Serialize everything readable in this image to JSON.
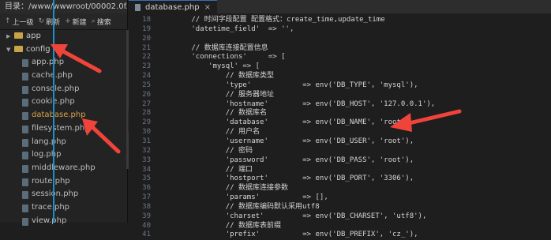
{
  "window": {
    "dir_label": "目录：/www/wwwroot/00002.0f..."
  },
  "toolbar": {
    "up": "上一级",
    "refresh": "刷新",
    "new": "新建",
    "search": "搜索"
  },
  "tree": [
    {
      "type": "folder",
      "label": "app",
      "open": false
    },
    {
      "type": "folder",
      "label": "config",
      "open": true
    },
    {
      "type": "file",
      "label": "app.php"
    },
    {
      "type": "file",
      "label": "cache.php"
    },
    {
      "type": "file",
      "label": "console.php"
    },
    {
      "type": "file",
      "label": "cookie.php"
    },
    {
      "type": "file",
      "label": "database.php",
      "active": true
    },
    {
      "type": "file",
      "label": "filesystem.php"
    },
    {
      "type": "file",
      "label": "lang.php"
    },
    {
      "type": "file",
      "label": "log.php"
    },
    {
      "type": "file",
      "label": "middleware.php"
    },
    {
      "type": "file",
      "label": "route.php"
    },
    {
      "type": "file",
      "label": "session.php"
    },
    {
      "type": "file",
      "label": "trace.php"
    },
    {
      "type": "file",
      "label": "view.php"
    }
  ],
  "tab": {
    "label": "database.php"
  },
  "code_lines": [
    {
      "n": "18",
      "t": "        // 时间字段配置 配置格式：create_time,update_time"
    },
    {
      "n": "19",
      "t": "        'datetime_field'  => '',"
    },
    {
      "n": "20",
      "t": ""
    },
    {
      "n": "21",
      "t": "        // 数据库连接配置信息"
    },
    {
      "n": "22",
      "t": "        'connections'     => ["
    },
    {
      "n": "23",
      "t": "            'mysql' => ["
    },
    {
      "n": "24",
      "t": "                // 数据库类型"
    },
    {
      "n": "25",
      "t": "                'type'            => env('DB_TYPE', 'mysql'),"
    },
    {
      "n": "26",
      "t": "                // 服务器地址"
    },
    {
      "n": "27",
      "t": "                'hostname'        => env('DB_HOST', '127.0.0.1'),"
    },
    {
      "n": "28",
      "t": "                // 数据库名"
    },
    {
      "n": "29",
      "t": "                'database'        => env('DB_NAME', 'root'),"
    },
    {
      "n": "30",
      "t": "                // 用户名"
    },
    {
      "n": "31",
      "t": "                'username'        => env('DB_USER', 'root'),"
    },
    {
      "n": "32",
      "t": "                // 密码"
    },
    {
      "n": "33",
      "t": "                'password'        => env('DB_PASS', 'root'),"
    },
    {
      "n": "34",
      "t": "                // 端口"
    },
    {
      "n": "35",
      "t": "                'hostport'        => env('DB_PORT', '3306'),"
    },
    {
      "n": "36",
      "t": "                // 数据库连接参数"
    },
    {
      "n": "37",
      "t": "                'params'          => [],"
    },
    {
      "n": "38",
      "t": "                // 数据库编码默认采用utf8"
    },
    {
      "n": "39",
      "t": "                'charset'         => env('DB_CHARSET', 'utf8'),"
    },
    {
      "n": "40",
      "t": "                // 数据库表前缀"
    },
    {
      "n": "41",
      "t": "                'prefix'          => env('DB_PREFIX', 'cz_'),"
    }
  ],
  "colors": {
    "annotation_arrow": "#f0443a",
    "active_file": "#d9a54a",
    "guide_line": "#1b8fd1"
  }
}
